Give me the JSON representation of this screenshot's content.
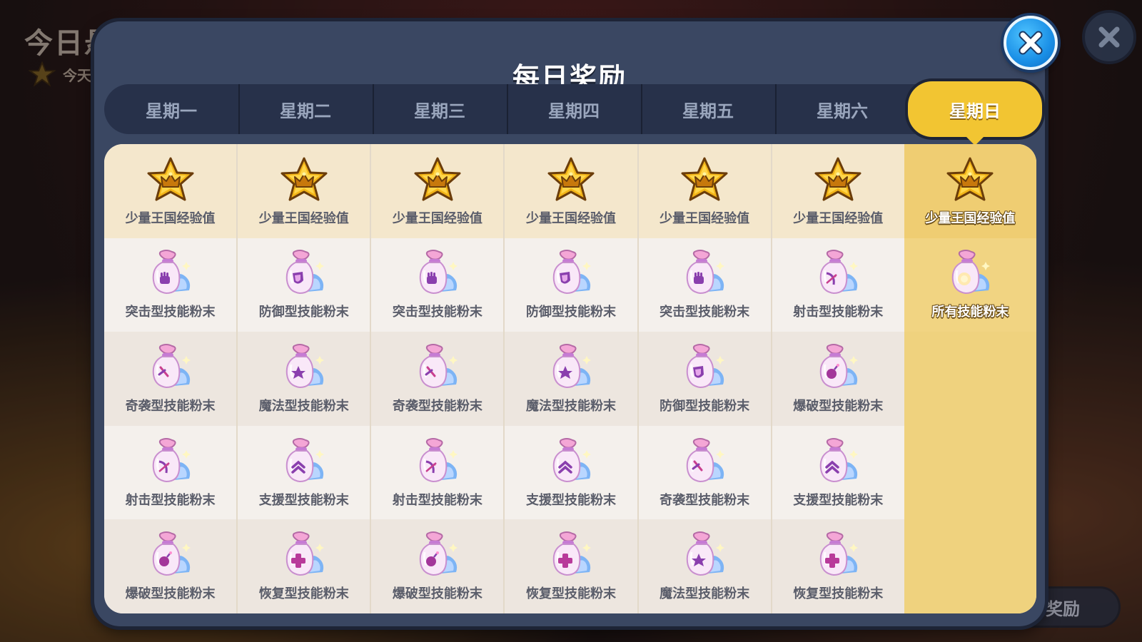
{
  "background": {
    "title": "今日悬",
    "subtitle": "今天",
    "bottom_button": "日奖励"
  },
  "dialog": {
    "title": "每日奖励"
  },
  "tabs": [
    {
      "label": "星期一",
      "active": false
    },
    {
      "label": "星期二",
      "active": false
    },
    {
      "label": "星期三",
      "active": false
    },
    {
      "label": "星期四",
      "active": false
    },
    {
      "label": "星期五",
      "active": false
    },
    {
      "label": "星期六",
      "active": false
    },
    {
      "label": "星期日",
      "active": true
    }
  ],
  "colors": {
    "accent": "#f2c532",
    "panel": "#3a4762",
    "close": "#1a8fe6"
  },
  "rewards": [
    [
      {
        "label": "少量王国经验值",
        "icon": "kingdom-star-icon"
      },
      {
        "label": "突击型技能粉末",
        "icon": "fist"
      },
      {
        "label": "奇袭型技能粉末",
        "icon": "dagger"
      },
      {
        "label": "射击型技能粉末",
        "icon": "bow"
      },
      {
        "label": "爆破型技能粉末",
        "icon": "bomb"
      }
    ],
    [
      {
        "label": "少量王国经验值",
        "icon": "kingdom-star-icon"
      },
      {
        "label": "防御型技能粉末",
        "icon": "shield"
      },
      {
        "label": "魔法型技能粉末",
        "icon": "star"
      },
      {
        "label": "支援型技能粉末",
        "icon": "chevron"
      },
      {
        "label": "恢复型技能粉末",
        "icon": "cross"
      }
    ],
    [
      {
        "label": "少量王国经验值",
        "icon": "kingdom-star-icon"
      },
      {
        "label": "突击型技能粉末",
        "icon": "fist"
      },
      {
        "label": "奇袭型技能粉末",
        "icon": "dagger"
      },
      {
        "label": "射击型技能粉末",
        "icon": "bow"
      },
      {
        "label": "爆破型技能粉末",
        "icon": "bomb"
      }
    ],
    [
      {
        "label": "少量王国经验值",
        "icon": "kingdom-star-icon"
      },
      {
        "label": "防御型技能粉末",
        "icon": "shield"
      },
      {
        "label": "魔法型技能粉末",
        "icon": "star"
      },
      {
        "label": "支援型技能粉末",
        "icon": "chevron"
      },
      {
        "label": "恢复型技能粉末",
        "icon": "cross"
      }
    ],
    [
      {
        "label": "少量王国经验值",
        "icon": "kingdom-star-icon"
      },
      {
        "label": "突击型技能粉末",
        "icon": "fist"
      },
      {
        "label": "防御型技能粉末",
        "icon": "shield"
      },
      {
        "label": "奇袭型技能粉末",
        "icon": "dagger"
      },
      {
        "label": "魔法型技能粉末",
        "icon": "star"
      }
    ],
    [
      {
        "label": "少量王国经验值",
        "icon": "kingdom-star-icon"
      },
      {
        "label": "射击型技能粉末",
        "icon": "bow"
      },
      {
        "label": "爆破型技能粉末",
        "icon": "bomb"
      },
      {
        "label": "支援型技能粉末",
        "icon": "chevron"
      },
      {
        "label": "恢复型技能粉末",
        "icon": "cross"
      }
    ],
    [
      {
        "label": "少量王国经验值",
        "icon": "kingdom-star-icon"
      },
      {
        "label": "所有技能粉末",
        "icon": "all"
      }
    ]
  ]
}
